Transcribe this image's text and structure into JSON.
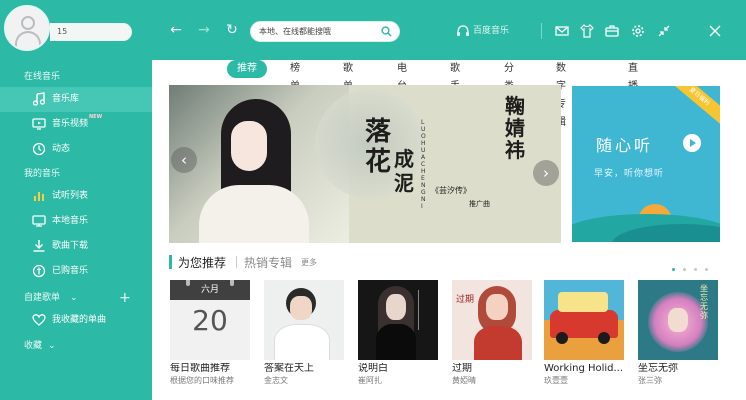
{
  "user": {
    "name": "15"
  },
  "sidebar": {
    "section_online": "在线音乐",
    "items_online": [
      {
        "label": "音乐库",
        "icon": "music-note-icon",
        "active": true
      },
      {
        "label": "音乐视频",
        "icon": "tv-icon",
        "badge": "NEW"
      },
      {
        "label": "动态",
        "icon": "compass-icon"
      }
    ],
    "section_mine": "我的音乐",
    "items_mine": [
      {
        "label": "试听列表",
        "icon": "bars-icon"
      },
      {
        "label": "本地音乐",
        "icon": "monitor-icon"
      },
      {
        "label": "歌曲下载",
        "icon": "download-icon"
      },
      {
        "label": "已购音乐",
        "icon": "coin-icon"
      }
    ],
    "section_playlists": "自建歌单",
    "playlist_item": {
      "label": "我收藏的单曲",
      "icon": "heart-icon"
    },
    "section_favorites": "收藏"
  },
  "topbar": {
    "search_placeholder": "本地、在线都能搜哦",
    "brand": "百度音乐"
  },
  "tabs": [
    "推荐",
    "榜单",
    "歌单",
    "电台",
    "歌手",
    "分类",
    "数字专辑",
    "直播"
  ],
  "banner": {
    "callig_1": "落花",
    "callig_2": "成泥",
    "callig_3": "鞠婧祎",
    "vertical": "LUOHUACHENGNI",
    "subtitle": "《芸汐传》",
    "subtitle2": "推广曲",
    "slides": 8,
    "active_slide": 7
  },
  "banner2": {
    "ribbon": "夏日福利",
    "title": "随心听",
    "sub": "早安，听你想听"
  },
  "section": {
    "recommend": "为您推荐",
    "hot_albums": "热销专辑",
    "more": "更多"
  },
  "cards": [
    {
      "name": "每日歌曲推荐",
      "artist": "根据您的口味推荐",
      "month": "六月",
      "day": "20"
    },
    {
      "name": "答案在天上",
      "artist": "金志文",
      "cover_text": ""
    },
    {
      "name": "说明白",
      "artist": "崔阿扎"
    },
    {
      "name": "过期",
      "artist": "黄婭晴"
    },
    {
      "name": "Working Holid...",
      "artist": "玖壹壹"
    },
    {
      "name": "坐忘无弥",
      "artist": "张三弥"
    }
  ],
  "colors": {
    "accent": "#2cb9a6"
  }
}
